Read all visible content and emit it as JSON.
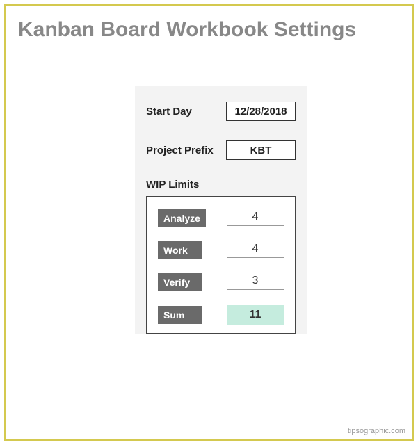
{
  "title": "Kanban Board Workbook Settings",
  "fields": {
    "start_day": {
      "label": "Start Day",
      "value": "12/28/2018"
    },
    "project_prefix": {
      "label": "Project Prefix",
      "value": "KBT"
    }
  },
  "wip": {
    "section_label": "WIP Limits",
    "rows": [
      {
        "label": "Analyze",
        "value": "4"
      },
      {
        "label": "Work",
        "value": "4"
      },
      {
        "label": "Verify",
        "value": "3"
      }
    ],
    "sum": {
      "label": "Sum",
      "value": "11"
    }
  },
  "footer": {
    "right": "tipsographic.com"
  }
}
